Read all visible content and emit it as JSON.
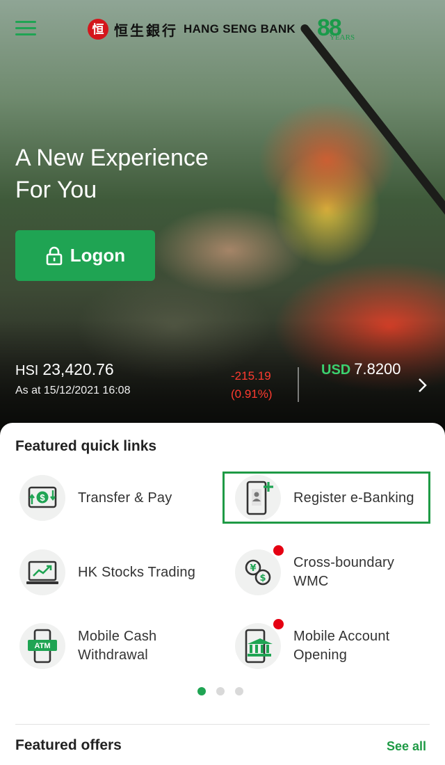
{
  "header": {
    "menu_icon": "hamburger-menu-icon",
    "brand_cn": "恒生銀行",
    "brand_en": "HANG SENG BANK",
    "anniversary_number": "88",
    "anniversary_label": "YEARS",
    "brand_color": "#d4161c",
    "accent_color": "#1fa453"
  },
  "hero": {
    "title_line1": "A New Experience",
    "title_line2": "For You",
    "logon_label": "Logon",
    "logon_icon": "lock-icon"
  },
  "ticker": {
    "index_name": "HSI",
    "index_value": "23,420.76",
    "as_at": "As at 15/12/2021 16:08",
    "change": "-215.19",
    "change_pct": "(0.91%)",
    "change_color": "#ff3b30",
    "currency": "USD",
    "rate": "7.8200",
    "next_icon": "chevron-right-icon"
  },
  "quick_links": {
    "title": "Featured quick links",
    "items": [
      {
        "label": "Transfer & Pay",
        "icon": "transfer-money-icon",
        "badge": false
      },
      {
        "label": "Register e-Banking",
        "icon": "register-phone-icon",
        "badge": false,
        "highlighted": true
      },
      {
        "label": "HK Stocks Trading",
        "icon": "stock-chart-laptop-icon",
        "badge": false
      },
      {
        "label_line1": "Cross-boundary",
        "label_line2": "WMC",
        "icon": "currency-exchange-icon",
        "badge": true
      },
      {
        "label_line1": "Mobile Cash",
        "label_line2": "Withdrawal",
        "icon": "atm-phone-icon",
        "badge": true
      },
      {
        "label_line1": "Mobile Account",
        "label_line2": "Opening",
        "icon": "bank-phone-icon",
        "badge": true
      }
    ],
    "pager": {
      "pages": 3,
      "current": 1
    }
  },
  "offers": {
    "title": "Featured offers",
    "see_all": "See all"
  }
}
